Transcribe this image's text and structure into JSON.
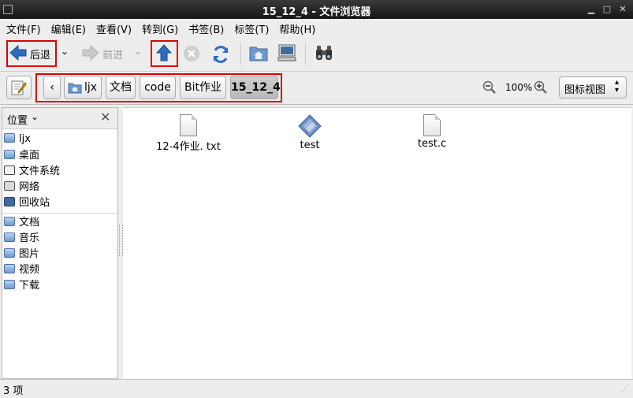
{
  "window": {
    "title": "15_12_4 - 文件浏览器"
  },
  "menu": [
    "文件(F)",
    "编辑(E)",
    "查看(V)",
    "转到(G)",
    "书签(B)",
    "标签(T)",
    "帮助(H)"
  ],
  "toolbar": {
    "back_label": "后退",
    "forward_label": "前进"
  },
  "path": {
    "items": [
      "ljx",
      "文档",
      "code",
      "Bit作业",
      "15_12_4"
    ]
  },
  "zoom": {
    "level": "100%"
  },
  "view": {
    "mode": "图标视图"
  },
  "sidebar": {
    "header": "位置",
    "places": [
      "ljx",
      "桌面",
      "文件系统",
      "网络",
      "回收站"
    ],
    "bookmarks": [
      "文档",
      "音乐",
      "图片",
      "视频",
      "下载"
    ]
  },
  "files": [
    {
      "name": "12-4作业. txt",
      "kind": "text"
    },
    {
      "name": "test",
      "kind": "executable"
    },
    {
      "name": "test.c",
      "kind": "text"
    }
  ],
  "status": {
    "text": "3 项"
  }
}
